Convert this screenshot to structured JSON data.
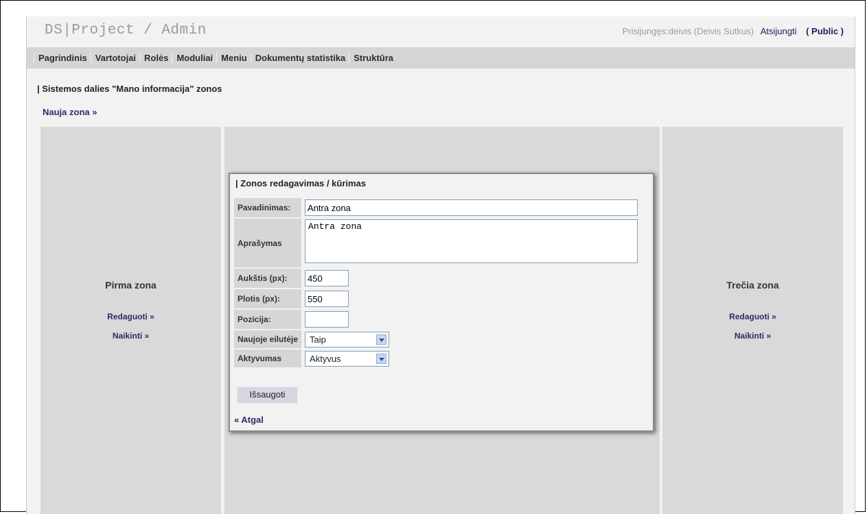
{
  "header": {
    "logo": "DS|Project / Admin",
    "login_info": "Prisijungęs:deivis (Deivis Sutkus)",
    "logout": "Atsijungti",
    "public": "( Public )"
  },
  "nav": {
    "items": [
      "Pagrindinis",
      "Vartotojai",
      "Rolės",
      "Moduliai",
      "Meniu",
      "Dokumentų statistika",
      "Struktūra"
    ]
  },
  "section_title": "| Sistemos dalies \"Mano informacija\" zonos",
  "new_zone": "Nauja zona »",
  "zones": [
    {
      "title": "Pirma zona",
      "edit": "Redaguoti »",
      "delete": "Naikinti »"
    },
    {
      "title": "Trečia zona",
      "edit": "Redaguoti »",
      "delete": "Naikinti »"
    }
  ],
  "editor": {
    "title": "| Zonos redagavimas / kūrimas",
    "fields": {
      "name_label": "Pavadinimas:",
      "name_value": "Antra zona",
      "description_label": "Aprašymas",
      "description_value": "Antra zona",
      "height_label": "Aukštis (px):",
      "height_value": "450",
      "width_label": "Plotis (px):",
      "width_value": "550",
      "position_label": "Pozicija:",
      "position_value": "",
      "newline_label": "Naujoje eilutėje",
      "newline_value": "Taip",
      "active_label": "Aktyvumas",
      "active_value": "Aktyvus"
    },
    "save_label": "Išsaugoti",
    "back_label": "« Atgal"
  }
}
